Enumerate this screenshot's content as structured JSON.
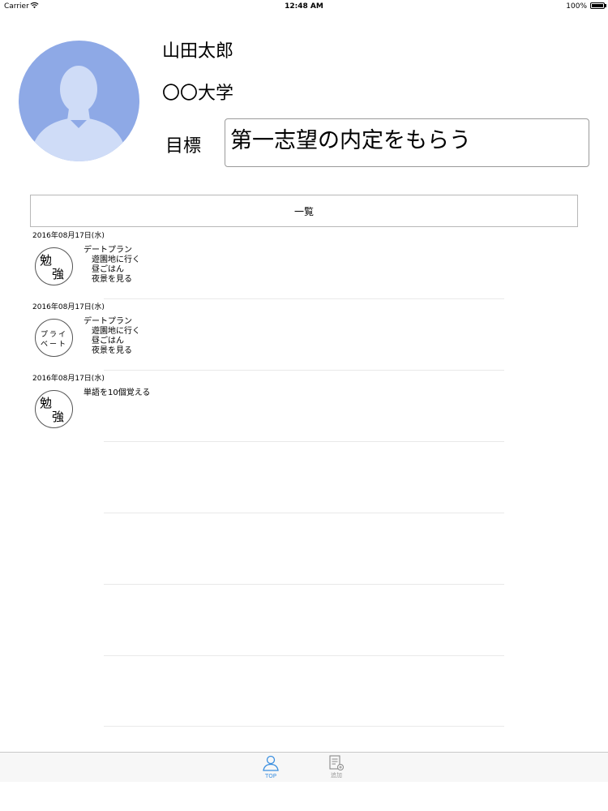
{
  "status_bar": {
    "carrier": "Carrier",
    "time": "12:48 AM",
    "battery": "100%",
    "battery_level": 1.0
  },
  "profile": {
    "name": "山田太郎",
    "university": "〇〇大学",
    "goal_label": "目標",
    "goal_value": "第一志望の内定をもらう"
  },
  "list_button": {
    "label": "一覧"
  },
  "entries": [
    {
      "date": "2016年08月17日(水)",
      "stamp": [
        "勉",
        "強"
      ],
      "text": "デートプラン\n　遊園地に行く\n　昼ごはん\n　夜景を見る"
    },
    {
      "date": "2016年08月17日(水)",
      "stamp": [
        "プライ",
        "ベート"
      ],
      "text": "デートプラン\n　遊園地に行く\n　昼ごはん\n　夜景を見る"
    },
    {
      "date": "2016年08月17日(水)",
      "stamp": [
        "勉",
        "強"
      ],
      "text": "単語を10個覚える"
    }
  ],
  "tabbar": {
    "tabs": [
      {
        "label": "TOP",
        "icon": "person-icon",
        "color": "#3b8fe0",
        "selected": true
      },
      {
        "label": "追加",
        "icon": "add-document-icon",
        "color": "#9a9a9a",
        "selected": false
      }
    ]
  }
}
